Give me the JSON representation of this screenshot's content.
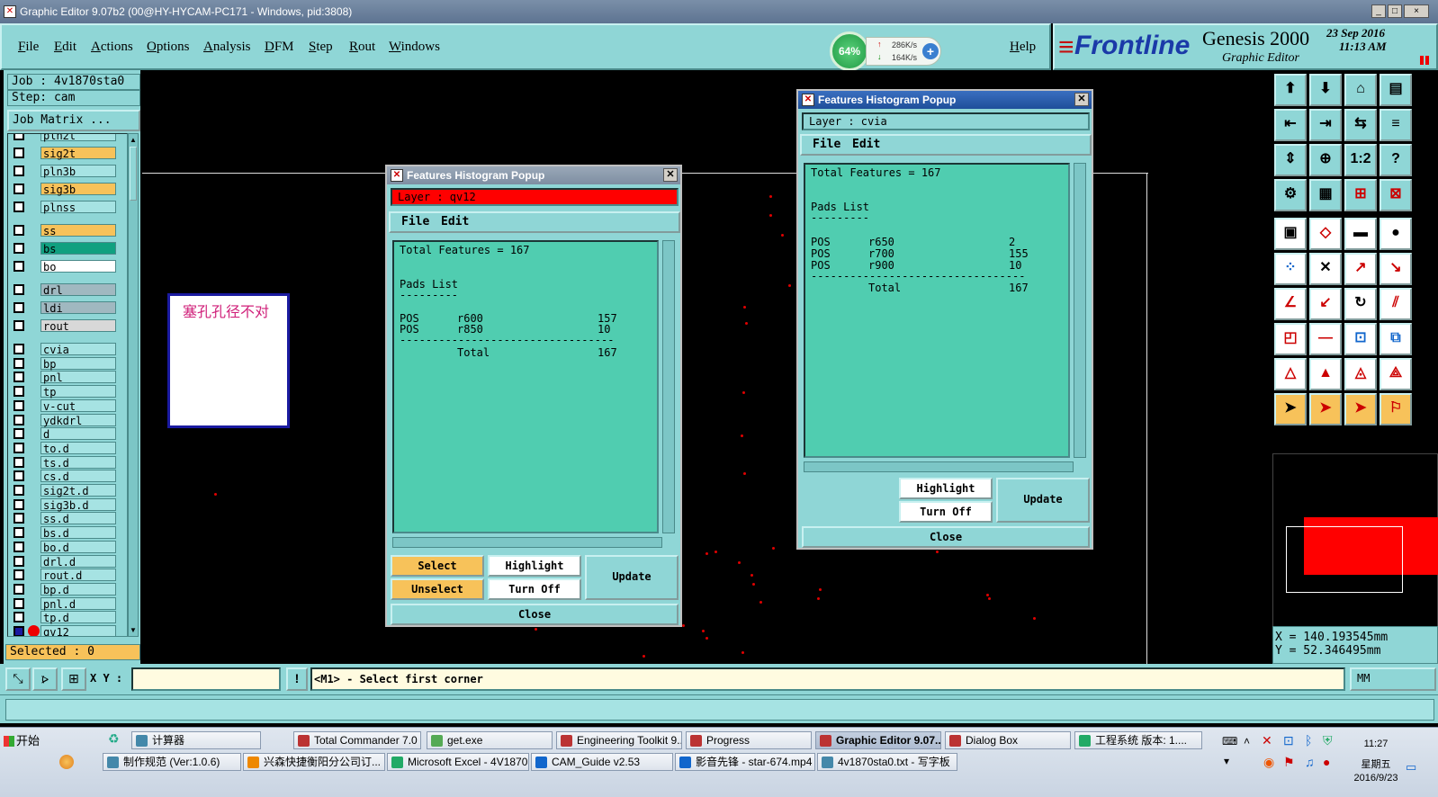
{
  "window": {
    "title": "Graphic Editor 9.07b2 (00@HY-HYCAM-PC171 - Windows, pid:3808)",
    "min": "_",
    "max": "□",
    "close": "×"
  },
  "menu": [
    "File",
    "Edit",
    "Actions",
    "Options",
    "Analysis",
    "DFM",
    "Step",
    "Rout",
    "Windows"
  ],
  "help": "Help",
  "net": {
    "percent": "64%",
    "up": "286K/s",
    "down": "164K/s"
  },
  "logo": {
    "brand": "Frontline",
    "product": "Genesis 2000",
    "sub": "Graphic Editor",
    "date": "23 Sep 2016",
    "time": "11:13 AM"
  },
  "job": {
    "job": "Job : 4v1870sta0",
    "step": "Step: cam",
    "matrix_btn": "Job Matrix ...",
    "selected": "Selected : 0"
  },
  "layers": [
    {
      "name": "pln2t",
      "color": "#a6e3e3"
    },
    {
      "name": "sig2t",
      "color": "#f7c25a"
    },
    {
      "name": "pln3b",
      "color": "#a6e3e3"
    },
    {
      "name": "sig3b",
      "color": "#f7c25a"
    },
    {
      "name": "plnss",
      "color": "#a6e3e3"
    },
    {
      "name": "ss",
      "color": "#f7c25a"
    },
    {
      "name": "bs",
      "color": "#10a080"
    },
    {
      "name": "bo",
      "color": "#ffffff"
    },
    {
      "name": "drl",
      "color": "#a0b8c0"
    },
    {
      "name": "ldi",
      "color": "#a0b8c0"
    },
    {
      "name": "rout",
      "color": "#d8d8d8"
    },
    {
      "name": "cvia",
      "color": "#a6e3e3"
    },
    {
      "name": "bp",
      "color": "#a6e3e3"
    },
    {
      "name": "pnl",
      "color": "#a6e3e3"
    },
    {
      "name": "tp",
      "color": "#a6e3e3"
    },
    {
      "name": "v-cut",
      "color": "#a6e3e3"
    },
    {
      "name": "ydkdrl",
      "color": "#a6e3e3"
    },
    {
      "name": "d",
      "color": "#a6e3e3"
    },
    {
      "name": "to.d",
      "color": "#a6e3e3"
    },
    {
      "name": "ts.d",
      "color": "#a6e3e3"
    },
    {
      "name": "cs.d",
      "color": "#a6e3e3"
    },
    {
      "name": "sig2t.d",
      "color": "#a6e3e3"
    },
    {
      "name": "sig3b.d",
      "color": "#a6e3e3"
    },
    {
      "name": "ss.d",
      "color": "#a6e3e3"
    },
    {
      "name": "bs.d",
      "color": "#a6e3e3"
    },
    {
      "name": "bo.d",
      "color": "#a6e3e3"
    },
    {
      "name": "drl.d",
      "color": "#a6e3e3"
    },
    {
      "name": "rout.d",
      "color": "#a6e3e3"
    },
    {
      "name": "bp.d",
      "color": "#a6e3e3"
    },
    {
      "name": "pnl.d",
      "color": "#a6e3e3"
    },
    {
      "name": "tp.d",
      "color": "#a6e3e3"
    },
    {
      "name": "qv12",
      "color": "#a6e3e3"
    }
  ],
  "note": "塞孔孔径不对",
  "popup1": {
    "title": "Features Histogram Popup",
    "layer": "Layer :  qv12",
    "file": "File",
    "edit": "Edit",
    "total": "Total Features = 167",
    "pads": "Pads List",
    "dash": "---------",
    "rows": [
      [
        "POS",
        "r600",
        "157"
      ],
      [
        "POS",
        "r850",
        "10"
      ]
    ],
    "line": "---------------------------------",
    "sum": [
      "Total",
      "167"
    ],
    "btn": {
      "select": "Select",
      "unselect": "Unselect",
      "highlight": "Highlight",
      "turnoff": "Turn Off",
      "update": "Update",
      "close": "Close"
    }
  },
  "popup2": {
    "title": "Features Histogram Popup",
    "layer": "Layer :  cvia",
    "file": "File",
    "edit": "Edit",
    "total": "Total Features = 167",
    "pads": "Pads List",
    "dash": "---------",
    "rows": [
      [
        "POS",
        "r650",
        "2"
      ],
      [
        "POS",
        "r700",
        "155"
      ],
      [
        "POS",
        "r900",
        "10"
      ]
    ],
    "line": "---------------------------------",
    "sum": [
      "Total",
      "167"
    ],
    "btn": {
      "highlight": "Highlight",
      "turnoff": "Turn Off",
      "update": "Update",
      "close": "Close"
    }
  },
  "coords": {
    "x": "X = 140.193545mm",
    "y": "Y = 52.346495mm"
  },
  "status": {
    "xy_label": "X Y :",
    "message": "<M1> - Select first corner",
    "units": "MM"
  },
  "taskbar": {
    "start": "开始",
    "row1": [
      "计算器",
      "Total Commander 7.0 ...",
      "get.exe",
      "Engineering Toolkit 9....",
      "Progress",
      "Graphic Editor 9.07...",
      "Dialog Box",
      "工程系统  版本: 1...."
    ],
    "row2": [
      "制作规范 (Ver:1.0.6)",
      "兴森快捷衡阳分公司订...",
      "Microsoft Excel - 4V1870...",
      "CAM_Guide v2.53",
      "影音先锋 - star-674.mp4",
      "4v1870sta0.txt - 写字板"
    ],
    "clock": "11:27",
    "weekday": "星期五",
    "date": "2016/9/23"
  }
}
